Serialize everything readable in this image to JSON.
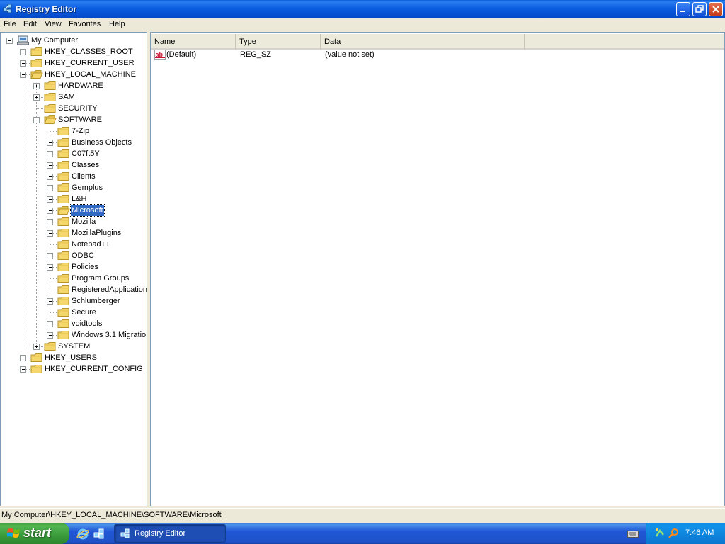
{
  "window": {
    "title": "Registry Editor"
  },
  "menu": [
    "File",
    "Edit",
    "View",
    "Favorites",
    "Help"
  ],
  "tree": {
    "root": "My Computer",
    "hives": {
      "classes_root": "HKEY_CLASSES_ROOT",
      "current_user": "HKEY_CURRENT_USER",
      "local_machine": "HKEY_LOCAL_MACHINE",
      "users": "HKEY_USERS",
      "current_config": "HKEY_CURRENT_CONFIG"
    },
    "local_machine_children": {
      "hardware": "HARDWARE",
      "sam": "SAM",
      "security": "SECURITY",
      "software": "SOFTWARE",
      "system": "SYSTEM"
    },
    "software_children": [
      "7-Zip",
      "Business Objects",
      "C07ft5Y",
      "Classes",
      "Clients",
      "Gemplus",
      "L&H",
      "Microsoft",
      "Mozilla",
      "MozillaPlugins",
      "Notepad++",
      "ODBC",
      "Policies",
      "Program Groups",
      "RegisteredApplication",
      "Schlumberger",
      "Secure",
      "voidtools",
      "Windows 3.1 Migratio"
    ],
    "selected": "Microsoft"
  },
  "list": {
    "columns": [
      "Name",
      "Type",
      "Data"
    ],
    "rows": [
      {
        "name": "(Default)",
        "type": "REG_SZ",
        "data": "(value not set)"
      }
    ]
  },
  "statusbar": {
    "path": "My Computer\\HKEY_LOCAL_MACHINE\\SOFTWARE\\Microsoft"
  },
  "taskbar": {
    "start_label": "start",
    "task_label": "Registry Editor",
    "clock": "7:46 AM"
  },
  "colors": {
    "selection": "#316ac5",
    "folder": "#f5d66a",
    "titlebar": "#0b5ee0",
    "start_green": "#3a9b3a"
  }
}
